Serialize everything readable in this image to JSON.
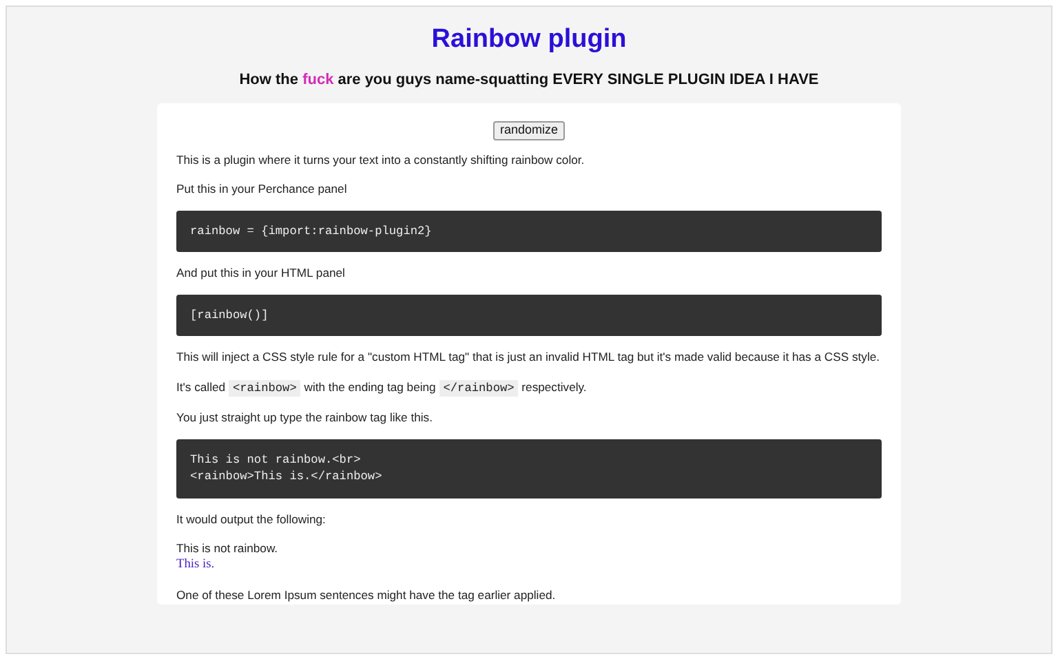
{
  "title": {
    "text": "Rainbow plugin",
    "color": "#2a10d8"
  },
  "subtitle": [
    {
      "text": "How the "
    },
    {
      "text": "fuck",
      "color": "#d42ab8"
    },
    {
      "text": " are you guys name-squatting EVERY SINGLE PLUGIN IDEA I HAVE"
    }
  ],
  "blocks": [
    {
      "kind": "button",
      "label": "randomize"
    },
    {
      "kind": "paragraph",
      "text": "This is a plugin where it turns your text into a constantly shifting rainbow color."
    },
    {
      "kind": "paragraph",
      "text": "Put this in your Perchance panel"
    },
    {
      "kind": "code",
      "lines": [
        "rainbow = {import:rainbow-plugin2}"
      ]
    },
    {
      "kind": "paragraph",
      "text": "And put this in your HTML panel"
    },
    {
      "kind": "code",
      "lines": [
        "[rainbow()]"
      ]
    },
    {
      "kind": "paragraph",
      "text": "This will inject a CSS style rule for a \"custom HTML tag\" that is just an invalid HTML tag but it's made valid because it has a CSS style."
    },
    {
      "kind": "mixed",
      "parts": [
        {
          "kind": "text",
          "text": "It's called "
        },
        {
          "kind": "code",
          "text": "<rainbow>"
        },
        {
          "kind": "text",
          "text": " with the ending tag being "
        },
        {
          "kind": "code",
          "text": "</rainbow>"
        },
        {
          "kind": "text",
          "text": " respectively."
        }
      ]
    },
    {
      "kind": "paragraph",
      "text": "You just straight up type the rainbow tag like this."
    },
    {
      "kind": "code",
      "lines": [
        "This is not rainbow.<br>",
        "<rainbow>This is.</rainbow>"
      ]
    },
    {
      "kind": "paragraph",
      "text": "It would output the following:"
    },
    {
      "kind": "output",
      "lines": [
        {
          "text": "This is not rainbow."
        },
        {
          "text": "This is.",
          "color": "#4b1fc4"
        }
      ]
    },
    {
      "kind": "paragraph",
      "text": "One of these Lorem Ipsum sentences might have the tag earlier applied."
    }
  ]
}
